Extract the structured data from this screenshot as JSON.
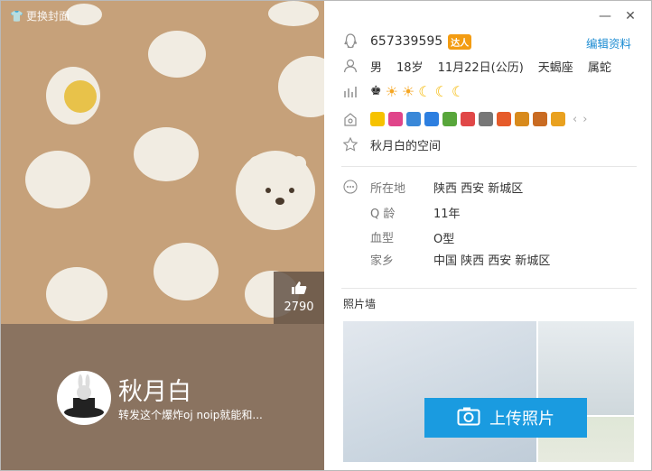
{
  "cover": {
    "change_cover_label": "更换封面",
    "like_count": "2790",
    "nickname": "秋月白",
    "signature": "转发这个爆炸oj noip就能和..."
  },
  "profile": {
    "qq_number": "657339595",
    "badge_text": "达人",
    "edit_label": "编辑资料",
    "basic": {
      "gender": "男",
      "age": "18岁",
      "birthday": "11月22日(公历)",
      "constellation": "天蝎座",
      "zodiac": "属蛇"
    },
    "space_label": "秋月白的空间",
    "details": {
      "location_label": "所在地",
      "location_value": "陕西 西安 新城区",
      "qage_label": "Q 龄",
      "qage_value": "11年",
      "blood_label": "血型",
      "blood_value": "O型",
      "hometown_label": "家乡",
      "hometown_value": "中国 陕西 西安 新城区"
    },
    "photowall_label": "照片墙",
    "upload_label": "上传照片"
  },
  "colors": {
    "cover_bg": "#c6a17a",
    "cover_bottom": "#8a7360",
    "accent": "#1a9be0",
    "link": "#1a8bd2"
  },
  "icons": [
    "qq-penguin-icon",
    "person-icon",
    "level-icon",
    "services-icon",
    "star-icon",
    "more-icon",
    "camera-icon",
    "thumb-up-icon",
    "close-icon",
    "minimize-icon"
  ]
}
